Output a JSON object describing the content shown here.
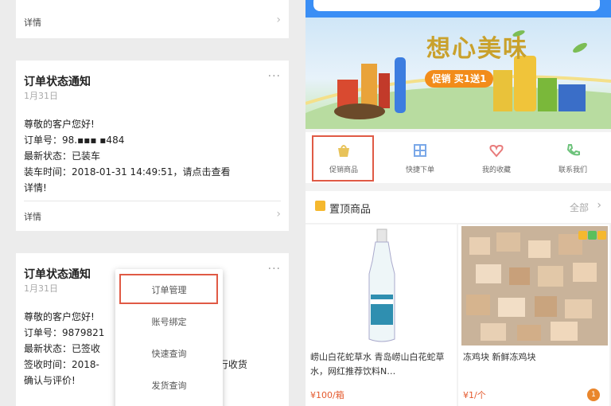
{
  "messages": [
    {
      "detail_label": "详情"
    },
    {
      "title": "订单状态通知",
      "date": "1月31日",
      "more": "···",
      "greeting": "尊敬的客户您好!",
      "order_no": "订单号：98.▪▪▪ ▪484",
      "latest_status": "最新状态：已装车",
      "time_line": "装车时间：2018-01-31 14:49:51，请点击查看",
      "time_line_2": "详情!",
      "detail_label": "详情"
    },
    {
      "title": "订单状态通知",
      "date": "1月31日",
      "more": "···",
      "greeting": "尊敬的客户您好!",
      "order_no": "订单号：9879821",
      "latest_status": "最新状态：已签收",
      "sign_time": "签收时间：2018-",
      "sign_time_tail": "进行收货",
      "confirm": "确认与评价!",
      "detail_label": "详情"
    }
  ],
  "popup_menu": {
    "items": [
      "订单管理",
      "账号绑定",
      "快速查询",
      "发货查询"
    ],
    "highlighted": "订单管理"
  },
  "banner": {
    "headline": "想心美味",
    "pill": "促销 买1送1"
  },
  "nav": {
    "items": [
      {
        "label": "促销商品",
        "icon": "bag-icon",
        "color": "#e8c35a"
      },
      {
        "label": "快捷下单",
        "icon": "grid-icon",
        "color": "#7aa8e8"
      },
      {
        "label": "我的收藏",
        "icon": "heart-icon",
        "color": "#e87a7a"
      },
      {
        "label": "联系我们",
        "icon": "phone-icon",
        "color": "#6cc27a"
      }
    ],
    "highlighted": "促销商品"
  },
  "section": {
    "title": "置顶商品",
    "all_label": "全部"
  },
  "products": [
    {
      "name": "崂山白花蛇草水 青岛崂山白花蛇草水，网红推荐饮料N…",
      "price": "¥100/箱"
    },
    {
      "name": "冻鸡块 新鲜冻鸡块",
      "price": "¥1/个",
      "cart_badge": "1"
    }
  ],
  "colors": {
    "accent": "#3a8ef5",
    "highlight_border": "#e05a45",
    "price": "#e45a2e"
  }
}
